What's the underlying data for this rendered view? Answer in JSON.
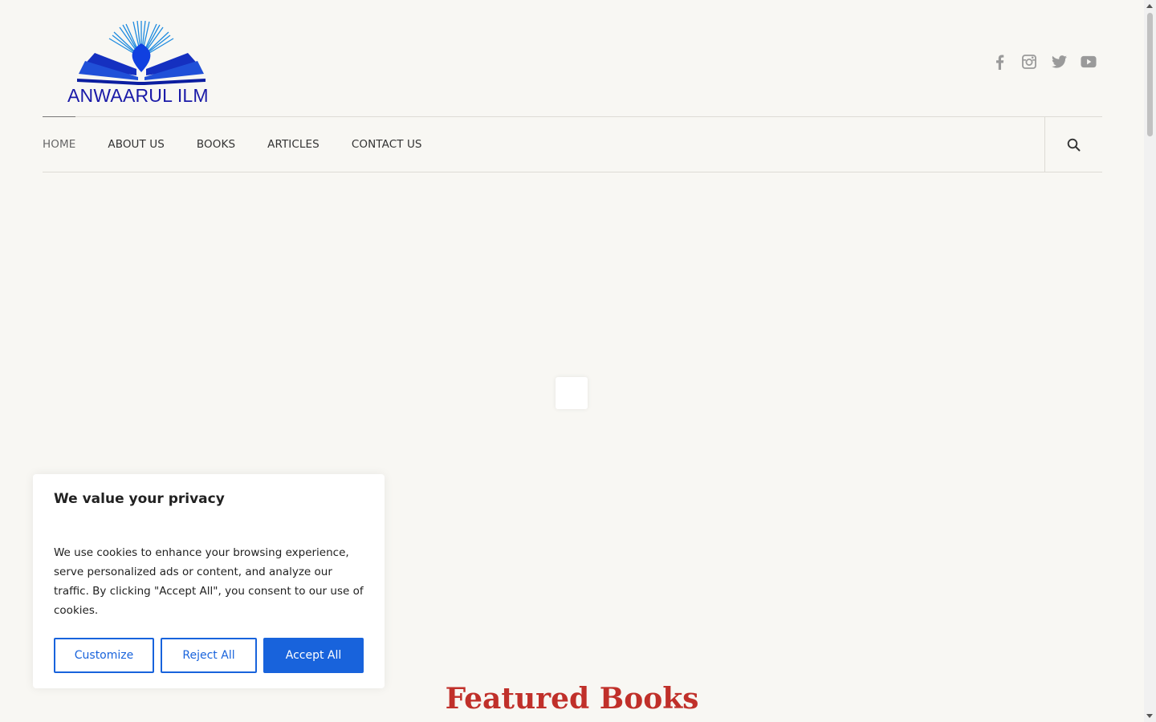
{
  "site": {
    "logo_text": "ANWAARUL ILM",
    "brand_color": "#1a1aa8"
  },
  "social": [
    {
      "name": "facebook-icon"
    },
    {
      "name": "instagram-icon"
    },
    {
      "name": "twitter-icon"
    },
    {
      "name": "youtube-icon"
    }
  ],
  "nav": {
    "items": [
      {
        "label": "HOME",
        "active": true
      },
      {
        "label": "ABOUT US"
      },
      {
        "label": "BOOKS"
      },
      {
        "label": "ARTICLES"
      },
      {
        "label": "CONTACT US"
      }
    ],
    "search_icon": "search-icon"
  },
  "main": {
    "featured_heading": "Featured Books",
    "featured_color": "#c0302a"
  },
  "cookie": {
    "title": "We value your privacy",
    "text": "We use cookies to enhance your browsing experience, serve personalized ads or content, and analyze our traffic. By clicking \"Accept All\", you consent to our use of cookies.",
    "customize_label": "Customize",
    "reject_label": "Reject All",
    "accept_label": "Accept All",
    "accent_color": "#1863dc"
  }
}
